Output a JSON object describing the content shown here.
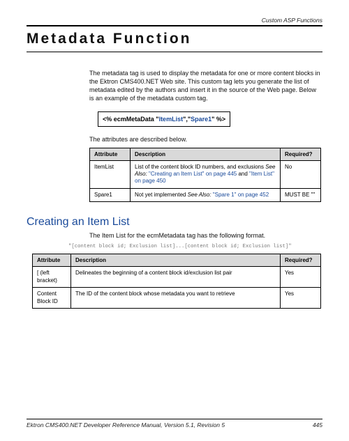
{
  "running_head": "Custom ASP Functions",
  "title": "Metadata Function",
  "intro": "The metadata tag is used to display the metadata for one or more content blocks in the Ektron CMS400.NET Web site. This custom tag lets you generate the list of metadata edited by the authors and insert it in the source of the Web page. Below is an example of the metadata custom tag.",
  "code_prefix": "<%  ecmMetaData \"",
  "code_link1": "ItemList",
  "code_mid": "\",\"",
  "code_link2": "Spare1",
  "code_suffix": "\" %>",
  "attr_intro": "The attributes are described below.",
  "table1": {
    "headers": [
      "Attribute",
      "Description",
      "Required?"
    ],
    "rows": [
      {
        "attr": "ItemList",
        "desc_before": "List of the content block ID numbers, and exclusions ",
        "see_also": "See Also: ",
        "link1": "\"Creating an Item List\" on page 445",
        "and": " and ",
        "link2": "\"Item List\" on page 450",
        "req": "No"
      },
      {
        "attr": "Spare1",
        "desc_before": "Not yet implemented ",
        "see_also": "See Also: ",
        "link1": "\"Spare 1\" on page 452",
        "req": "MUST BE \"\""
      }
    ]
  },
  "h2": "Creating an Item List",
  "h2_intro": "The Item List for the ecmMetadata tag has the following format.",
  "format_code": "\"[content block id; Exclusion list]...[content block id; Exclusion list]\"",
  "table2": {
    "headers": [
      "Attribute",
      "Description",
      "Required?"
    ],
    "rows": [
      {
        "attr": "[ (left bracket)",
        "desc": "Delineates the beginning of a content block id/exclusion list pair",
        "req": "Yes"
      },
      {
        "attr": "Content Block ID",
        "desc": "The ID of the content block whose metadata you want to retrieve",
        "req": "Yes"
      }
    ]
  },
  "footer_title": "Ektron CMS400.NET Developer Reference Manual, Version 5.1, Revision 5",
  "footer_page": "445"
}
